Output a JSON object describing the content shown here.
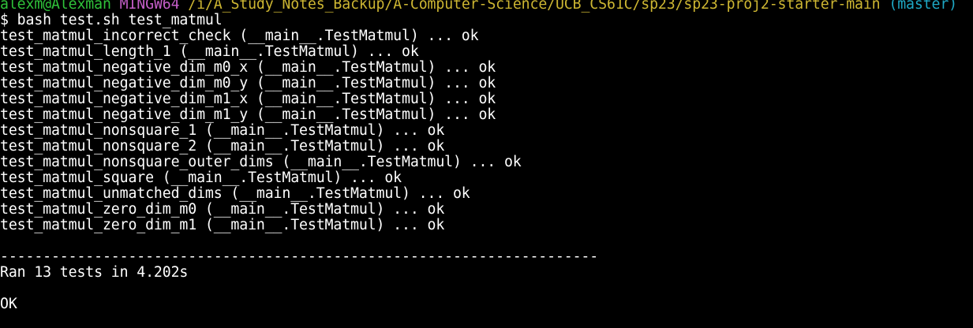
{
  "prompt": {
    "user_host": "alexm@Alexman",
    "system": "MINGW64",
    "path": "/i/A_Study_Notes_Backup/A-Computer-Science/UCB_CS61C/sp23/sp23-proj2-starter-main",
    "branch": "(master)"
  },
  "command": "$ bash test.sh test_matmul",
  "results": [
    "test_matmul_incorrect_check (__main__.TestMatmul) ... ok",
    "test_matmul_length_1 (__main__.TestMatmul) ... ok",
    "test_matmul_negative_dim_m0_x (__main__.TestMatmul) ... ok",
    "test_matmul_negative_dim_m0_y (__main__.TestMatmul) ... ok",
    "test_matmul_negative_dim_m1_x (__main__.TestMatmul) ... ok",
    "test_matmul_negative_dim_m1_y (__main__.TestMatmul) ... ok",
    "test_matmul_nonsquare_1 (__main__.TestMatmul) ... ok",
    "test_matmul_nonsquare_2 (__main__.TestMatmul) ... ok",
    "test_matmul_nonsquare_outer_dims (__main__.TestMatmul) ... ok",
    "test_matmul_square (__main__.TestMatmul) ... ok",
    "test_matmul_unmatched_dims (__main__.TestMatmul) ... ok",
    "test_matmul_zero_dim_m0 (__main__.TestMatmul) ... ok",
    "test_matmul_zero_dim_m1 (__main__.TestMatmul) ... ok"
  ],
  "separator": "----------------------------------------------------------------------",
  "summary": "Ran 13 tests in 4.202s",
  "status": "OK",
  "colors": {
    "background": "#000000",
    "text": "#ffffff",
    "user_host": "#2fc23a",
    "system": "#c35ec8",
    "path": "#cdb632",
    "branch": "#1ea8c5"
  }
}
